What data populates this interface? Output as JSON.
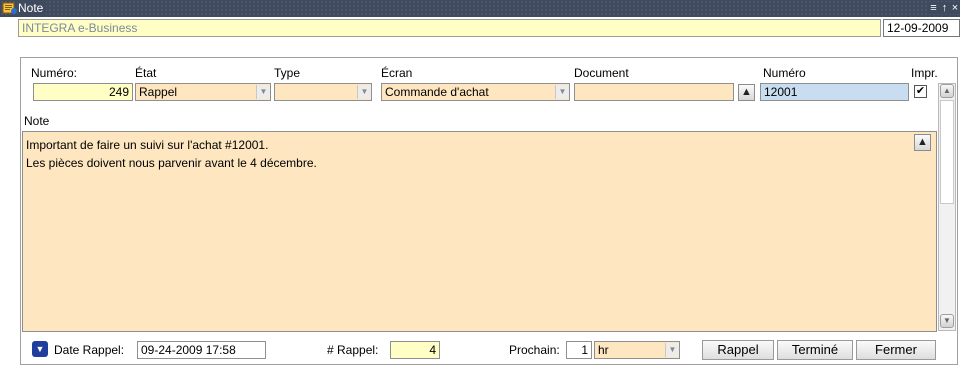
{
  "window": {
    "title": "Note",
    "icon": "note-app-icon",
    "controls": [
      "minimize-icon",
      "maximize-icon",
      "close-icon"
    ]
  },
  "company": {
    "name": "INTEGRA e-Business",
    "date": "12-09-2009"
  },
  "form": {
    "headers": {
      "numero": "Numéro:",
      "etat": "État",
      "type": "Type",
      "ecran": "Écran",
      "document": "Document",
      "numero2": "Numéro",
      "impr": "Impr."
    },
    "values": {
      "numero": "249",
      "etat": "Rappel",
      "type": "",
      "ecran": "Commande d'achat",
      "document": "",
      "numero2": "12001",
      "impr_checked": true,
      "impr_mark": "✔"
    },
    "note_label": "Note",
    "note_lines": [
      "Important de faire un suivi sur l'achat #12001.",
      "Les pièces doivent nous parvenir avant le 4 décembre."
    ]
  },
  "footer": {
    "date_rappel_label": "Date Rappel:",
    "date_rappel_value": "09-24-2009 17:58",
    "nb_rappel_label": "# Rappel:",
    "nb_rappel_value": "4",
    "prochain_label": "Prochain:",
    "prochain_value": "1",
    "prochain_unit": "hr",
    "buttons": {
      "rappel": "Rappel",
      "termine": "Terminé",
      "fermer": "Fermer"
    }
  },
  "colors": {
    "titlebar": "#3f4a5e",
    "field_peach": "#fde6c0",
    "field_yellow": "#fffec4",
    "field_blue": "#c8def0"
  }
}
